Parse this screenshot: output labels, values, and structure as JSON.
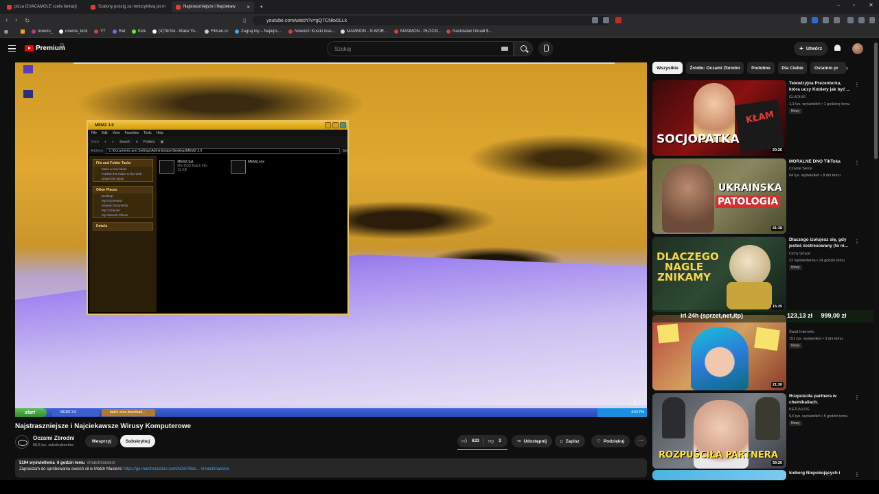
{
  "browser": {
    "tabs": [
      {
        "label": "pizza GUACAMOLE szefa fantazji",
        "active": false
      },
      {
        "label": "Szalony pościg za motocyklistą po m",
        "active": false
      },
      {
        "label": "Najstraszniejsze i Najciekaw",
        "active": true
      }
    ],
    "new_tab": "+",
    "url": "youtube.com/watch?v=gQ7CNkx0LLk",
    "bookmarks": [
      "nowciu_",
      "nowciu_kick",
      "YT",
      "Rat",
      "Kick",
      "(4)TikTok - Make Yo...",
      "Filman.cc",
      "Zagraj.my – Najleps...",
      "Nowość! Kostki mas...",
      "MAMMON - N WOR...",
      "MAMMON - PŁOCKI...",
      "Nastolatek Ukradł $..."
    ]
  },
  "header": {
    "logo_text": "Premium",
    "region": "PL",
    "search_placeholder": "Szukaj",
    "create_label": "Utwórz"
  },
  "video": {
    "title": "Najstraszniejsze i Najciekawsze Wirusy Komputerowe",
    "progress_fraction": 0.0,
    "xp": {
      "window_title": "MEMZ 3.0",
      "menu": [
        "File",
        "Edit",
        "View",
        "Favorites",
        "Tools",
        "Help"
      ],
      "toolbar": [
        "Back",
        "Search",
        "Folders"
      ],
      "address_label": "Address",
      "address": "C:\\Documents and Settings\\Administrator\\Desktop\\MEMZ 3.0",
      "go": "Go",
      "tasks_header": "File and Folder Tasks",
      "tasks": [
        "Make a new folder",
        "Publish this folder to the Web",
        "Share this folder"
      ],
      "places_header": "Other Places",
      "places": [
        "Desktop",
        "My Documents",
        "Shared Documents",
        "My Computer",
        "My Network Places"
      ],
      "details_header": "Details",
      "files": [
        {
          "name": "MEMZ.bat",
          "type": "MS-DOS Batch File",
          "size": "13 KB"
        },
        {
          "name": "MEMZ.exe"
        }
      ],
      "start": "start",
      "taskbar_items": [
        "MEMZ 3.0",
        "batch virus download..."
      ],
      "clock": "8:50 PM"
    }
  },
  "channel": {
    "name": "Oczami Zbrodni",
    "subscribers": "66,6 tys. subskrybentów",
    "support_label": "Wesprzyj",
    "subscribe_label": "Subskrybuj"
  },
  "actions": {
    "likes": "633",
    "dislikes": "3",
    "share": "Udostępnij",
    "save": "Zapisz",
    "thanks": "Podziękuj",
    "more": "⋯"
  },
  "description": {
    "views": "5194 wyświetlenia",
    "time": "6 godzin temu",
    "tag": "#matchmasters",
    "text": "Zapraszam do spróbowania swoich sił w Match Masters!",
    "link": "https://go.matchmasters.com/hCkF/l9an...",
    "hashtag": "#matchmasters"
  },
  "sidebar": {
    "chips": [
      "Wszystkie",
      "Źródło: Oczami Zbrodni",
      "Podobne",
      "Dla Ciebie",
      "Ostatnio pr"
    ],
    "items": [
      {
        "title": "Telewizyjna Prezenterka, która uczy Kobiety jak być ...",
        "channel": "GLADIUS",
        "meta": "1,1 tys. wyświetleń • 1 godzinę temu",
        "badge": "Nowy",
        "duration": "20:26",
        "thumb_text": "SOCJOPATKA",
        "thumb_text2": "KŁAM"
      },
      {
        "title": "MORALNE DNO TikToka",
        "channel": "Czarne Serce",
        "meta": "64 tys. wyświetleń • 8 dni temu",
        "badge": "",
        "duration": "41:38",
        "thumb_text": "UKRAIŃSKA",
        "thumb_text2": "PATOLOGIA"
      },
      {
        "title": "Dlaczego izolujesz się, gdy jesteś zestresowany (to ni...",
        "channel": "Cichy Umysł",
        "meta": "23 wyświetlenia • 14 godzin temu",
        "badge": "Nowy",
        "duration": "15:25",
        "thumb_text": "DLACZEGO NAGLE ZNIKAMY",
        "thumb_text2": ""
      },
      {
        "title": "",
        "channel": "Świat Internetu",
        "meta": "151 tys. wyświetleń • 3 dni temu",
        "badge": "Nowy",
        "duration": "21:30",
        "thumb_text": "",
        "thumb_text2": ""
      },
      {
        "title": "Rozpuściła partnera w chemikaliach.",
        "channel": "KEZUVLOG",
        "meta": "5,6 tys. wyświetleń • 5 godzin temu",
        "badge": "Nowy",
        "duration": "39:26",
        "thumb_text": "ROZPUŚCIŁA PARTNERA",
        "thumb_text2": ""
      },
      {
        "title": "Iceberg Niepokojących i",
        "channel": "",
        "meta": "",
        "badge": "",
        "duration": "",
        "thumb_text": "",
        "thumb_text2": ""
      }
    ],
    "overlay_left": "irl 24h (sprzet,net,itp)",
    "overlay_right": "123,13 zł     999,00 zł"
  }
}
